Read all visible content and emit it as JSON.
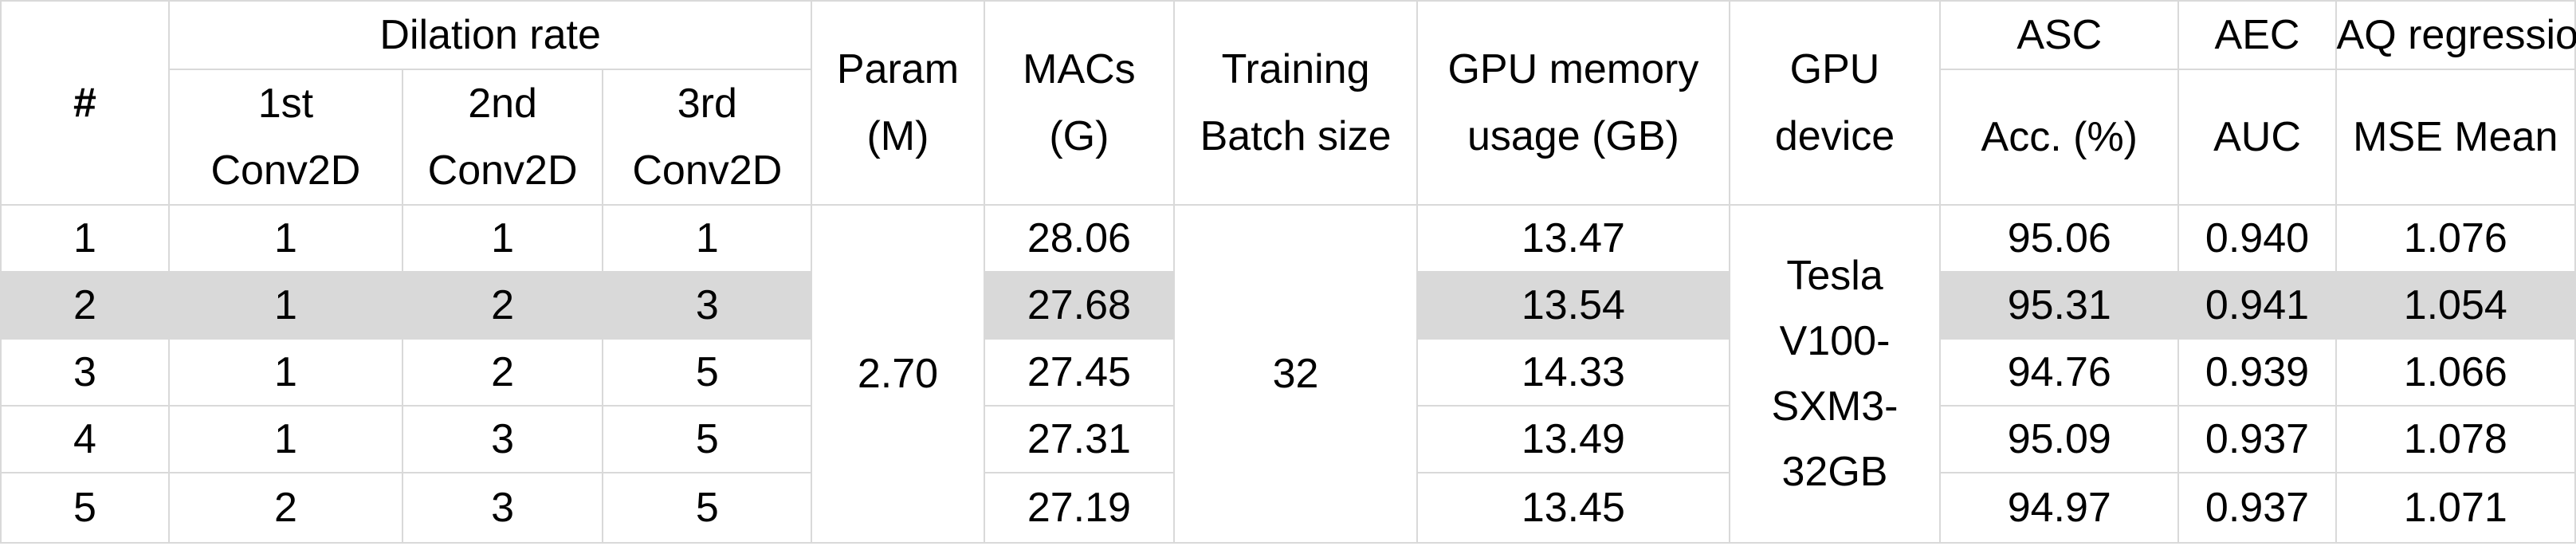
{
  "table": {
    "headers": {
      "index": "#",
      "dilation_rate": "Dilation rate",
      "conv1": [
        "1st",
        "Conv2D"
      ],
      "conv2": [
        "2nd",
        "Conv2D"
      ],
      "conv3": [
        "3rd",
        "Conv2D"
      ],
      "param": [
        "Param",
        "(M)"
      ],
      "macs": [
        "MACs",
        "(G)"
      ],
      "training": [
        "Training",
        "Batch size"
      ],
      "gpu_memory": [
        "GPU memory",
        "usage (GB)"
      ],
      "gpu_device": [
        "GPU",
        "device"
      ],
      "asc": "ASC",
      "asc_metric": "Acc. (%)",
      "aec": "AEC",
      "aec_metric": "AUC",
      "aq": "AQ regression",
      "aq_metric": "MSE Mean"
    },
    "shared": {
      "param": "2.70",
      "batch_size": "32",
      "gpu_device_lines": [
        "Tesla",
        "V100-",
        "SXM3-",
        "32GB"
      ]
    },
    "rows": [
      {
        "index": "1",
        "d1": "1",
        "d2": "1",
        "d3": "1",
        "macs": "28.06",
        "gpu_mem": "13.47",
        "asc": "95.06",
        "aec": "0.940",
        "aq": "1.076",
        "highlight": false
      },
      {
        "index": "2",
        "d1": "1",
        "d2": "2",
        "d3": "3",
        "macs": "27.68",
        "gpu_mem": "13.54",
        "asc": "95.31",
        "aec": "0.941",
        "aq": "1.054",
        "highlight": true
      },
      {
        "index": "3",
        "d1": "1",
        "d2": "2",
        "d3": "5",
        "macs": "27.45",
        "gpu_mem": "14.33",
        "asc": "94.76",
        "aec": "0.939",
        "aq": "1.066",
        "highlight": false
      },
      {
        "index": "4",
        "d1": "1",
        "d2": "3",
        "d3": "5",
        "macs": "27.31",
        "gpu_mem": "13.49",
        "asc": "95.09",
        "aec": "0.937",
        "aq": "1.078",
        "highlight": false
      },
      {
        "index": "5",
        "d1": "2",
        "d2": "3",
        "d3": "5",
        "macs": "27.19",
        "gpu_mem": "13.45",
        "asc": "94.97",
        "aec": "0.937",
        "aq": "1.071",
        "highlight": false
      }
    ],
    "highlight_color": "#d9d9d9",
    "border_color": "#d9d9d9"
  }
}
